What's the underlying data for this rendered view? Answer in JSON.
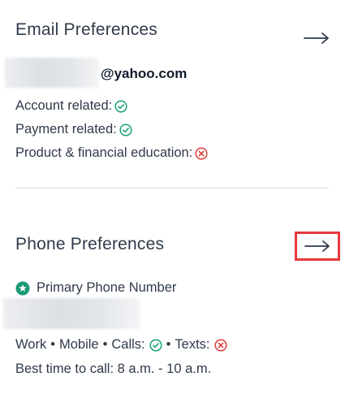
{
  "email_section": {
    "title": "Email Preferences",
    "email_domain": "@yahoo.com",
    "items": [
      {
        "label": "Account related:",
        "status": "enabled"
      },
      {
        "label": "Payment related:",
        "status": "enabled"
      },
      {
        "label": "Product & financial education:",
        "status": "disabled"
      }
    ]
  },
  "phone_section": {
    "title": "Phone Preferences",
    "primary_label": "Primary Phone Number",
    "type_line": {
      "work": "Work",
      "mobile": "Mobile",
      "bullet": "•",
      "calls_label": "Calls:",
      "calls_status": "enabled",
      "texts_label": "Texts:",
      "texts_status": "disabled"
    },
    "best_time": "Best time to call: 8 a.m. - 10 a.m."
  },
  "icons": {
    "arrow": "arrow-right-icon",
    "enabled": "check-circle-icon",
    "disabled": "x-circle-icon",
    "primary": "star-circle-icon"
  },
  "colors": {
    "text": "#2f3a4a",
    "enabled": "#1aa37a",
    "disabled": "#e03b3b",
    "primary_star": "#1a9a76",
    "highlight": "#e8373e"
  }
}
